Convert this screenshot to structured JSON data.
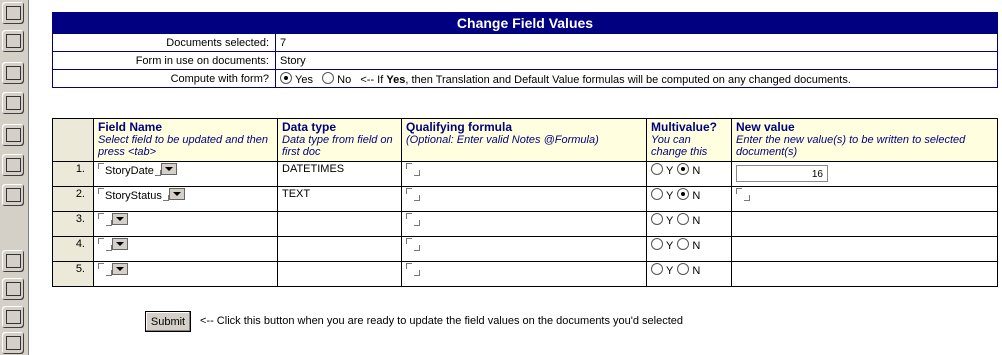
{
  "form": {
    "title": "Change Field Values",
    "documents_selected_label": "Documents selected:",
    "documents_selected_value": "7",
    "form_in_use_label": "Form in use on documents:",
    "form_in_use_value": "Story",
    "compute_label": "Compute with form?",
    "compute_yes": "Yes",
    "compute_no": "No",
    "compute_selected": "Yes",
    "compute_note_arrow": "<--",
    "compute_note_prefix": "If",
    "compute_note_bold": "Yes",
    "compute_note_rest": ", then Translation and Default Value formulas will be computed on any changed documents."
  },
  "table": {
    "headers": {
      "field_name": "Field Name",
      "field_name_hint": "Select field to be updated and then press <tab>",
      "data_type": "Data type",
      "data_type_hint": "Data type from field on first doc",
      "qualifying": "Qualifying formula",
      "qualifying_hint": "(Optional: Enter valid Notes @Formula)",
      "multivalue": "Multivalue?",
      "multivalue_hint": "You can change this",
      "new_value": "New value",
      "new_value_hint": "Enter the new value(s) to be written to selected document(s)"
    },
    "rows": [
      {
        "num": "1.",
        "field": "StoryDate",
        "type": "DATETIMES",
        "multi": "N",
        "new_value": "16"
      },
      {
        "num": "2.",
        "field": "StoryStatus",
        "type": "TEXT",
        "multi": "N",
        "new_value": ""
      },
      {
        "num": "3.",
        "field": "",
        "type": "",
        "multi": "",
        "new_value": ""
      },
      {
        "num": "4.",
        "field": "",
        "type": "",
        "multi": "",
        "new_value": ""
      },
      {
        "num": "5.",
        "field": "",
        "type": "",
        "multi": "",
        "new_value": ""
      }
    ],
    "radio_y": "Y",
    "radio_n": "N"
  },
  "footer": {
    "submit_label": "Submit",
    "submit_note": "<-- Click this button when you are ready to update the field values on the documents you'd selected"
  },
  "colors": {
    "title_bg": "#000080",
    "header_bg": "#ffffe0",
    "header_text": "#000080"
  }
}
